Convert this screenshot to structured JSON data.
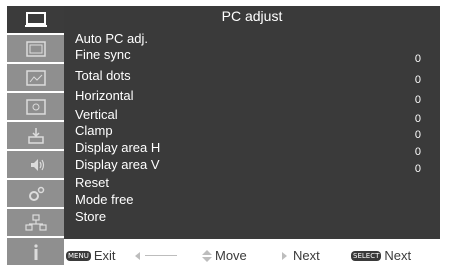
{
  "header": {
    "title": "PC adjust"
  },
  "sidebar": {
    "items": [
      {
        "icon": "monitor-icon",
        "active": true
      },
      {
        "icon": "image-select-icon",
        "active": false
      },
      {
        "icon": "image-adjust-icon",
        "active": false
      },
      {
        "icon": "screen-icon",
        "active": false
      },
      {
        "icon": "input-icon",
        "active": false
      },
      {
        "icon": "sound-icon",
        "active": false
      },
      {
        "icon": "setting-icon",
        "active": false
      },
      {
        "icon": "network-icon",
        "active": false
      },
      {
        "icon": "info-icon",
        "active": false
      }
    ]
  },
  "menu": {
    "items": [
      {
        "label": "Auto PC adj.",
        "value": ""
      },
      {
        "label": "Fine sync",
        "value": "0"
      },
      {
        "label": "Total dots",
        "value": "0"
      },
      {
        "label": "Horizontal",
        "value": "0"
      },
      {
        "label": "Vertical",
        "value": "0"
      },
      {
        "label": "Clamp",
        "value": "0"
      },
      {
        "label": "Display area H",
        "value": "0"
      },
      {
        "label": "Display area V",
        "value": "0"
      },
      {
        "label": "Reset",
        "value": ""
      },
      {
        "label": "Mode free",
        "value": ""
      },
      {
        "label": "Store",
        "value": ""
      }
    ]
  },
  "footer": {
    "menu_key": "MENU",
    "exit_label": "Exit",
    "move_label": "Move",
    "next_label": "Next",
    "select_key": "SELECT",
    "select_next_label": "Next"
  },
  "colors": {
    "panel": "#3a3a3a",
    "sidebar_item": "#8f8f8f",
    "sidebar_active": "#3b3b3b",
    "text": "#ffffff"
  }
}
